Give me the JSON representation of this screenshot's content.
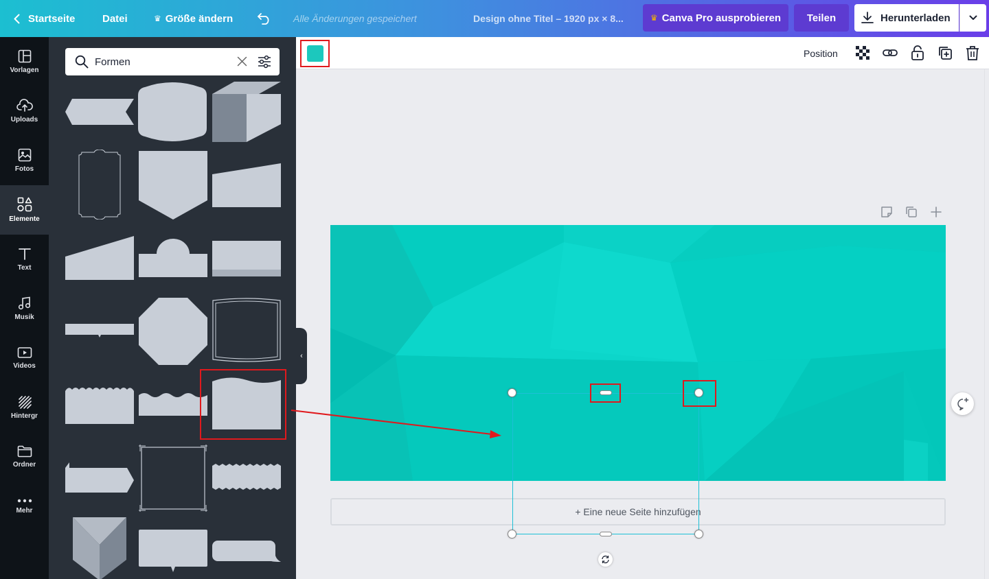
{
  "topbar": {
    "home_label": "Startseite",
    "file_label": "Datei",
    "resize_label": "Größe ändern",
    "saved_status": "Alle Änderungen gespeichert",
    "design_title": "Design ohne Titel – 1920 px × 8...",
    "pro_label": "Canva Pro ausprobieren",
    "share_label": "Teilen",
    "download_label": "Herunterladen",
    "crown_icon": "crown-icon"
  },
  "rail": {
    "items": [
      {
        "label": "Vorlagen",
        "icon": "template-icon"
      },
      {
        "label": "Uploads",
        "icon": "cloud-upload-icon"
      },
      {
        "label": "Fotos",
        "icon": "photo-icon"
      },
      {
        "label": "Elemente",
        "icon": "shapes-icon",
        "active": true
      },
      {
        "label": "Text",
        "icon": "text-icon"
      },
      {
        "label": "Musik",
        "icon": "music-icon"
      },
      {
        "label": "Videos",
        "icon": "video-icon"
      },
      {
        "label": "Hintergr",
        "icon": "background-icon"
      },
      {
        "label": "Ordner",
        "icon": "folder-icon"
      },
      {
        "label": "Mehr",
        "icon": "more-icon"
      }
    ]
  },
  "panel": {
    "search_value": "Formen",
    "shapes_count": 21
  },
  "context_toolbar": {
    "position_label": "Position",
    "color_swatch": "#1cc8bd"
  },
  "canvas": {
    "add_page_label": "+ Eine neue Seite hinzufügen",
    "background_color": "#04c8bb"
  },
  "colors": {
    "accent_purple": "#5d3bd1",
    "panel_bg": "#293039",
    "rail_bg": "#0e1318",
    "shape_fill": "#c8ced7",
    "selection": "#1cc0d6",
    "annotation_red": "#e0191d"
  }
}
